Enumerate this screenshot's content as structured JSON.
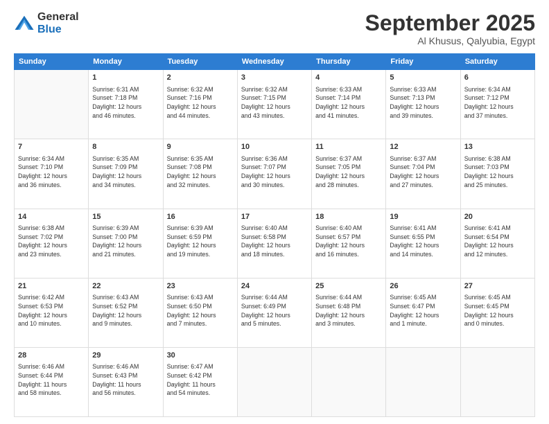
{
  "logo": {
    "general": "General",
    "blue": "Blue"
  },
  "title": "September 2025",
  "location": "Al Khusus, Qalyubia, Egypt",
  "headers": [
    "Sunday",
    "Monday",
    "Tuesday",
    "Wednesday",
    "Thursday",
    "Friday",
    "Saturday"
  ],
  "weeks": [
    [
      {
        "day": "",
        "info": ""
      },
      {
        "day": "1",
        "info": "Sunrise: 6:31 AM\nSunset: 7:18 PM\nDaylight: 12 hours\nand 46 minutes."
      },
      {
        "day": "2",
        "info": "Sunrise: 6:32 AM\nSunset: 7:16 PM\nDaylight: 12 hours\nand 44 minutes."
      },
      {
        "day": "3",
        "info": "Sunrise: 6:32 AM\nSunset: 7:15 PM\nDaylight: 12 hours\nand 43 minutes."
      },
      {
        "day": "4",
        "info": "Sunrise: 6:33 AM\nSunset: 7:14 PM\nDaylight: 12 hours\nand 41 minutes."
      },
      {
        "day": "5",
        "info": "Sunrise: 6:33 AM\nSunset: 7:13 PM\nDaylight: 12 hours\nand 39 minutes."
      },
      {
        "day": "6",
        "info": "Sunrise: 6:34 AM\nSunset: 7:12 PM\nDaylight: 12 hours\nand 37 minutes."
      }
    ],
    [
      {
        "day": "7",
        "info": "Sunrise: 6:34 AM\nSunset: 7:10 PM\nDaylight: 12 hours\nand 36 minutes."
      },
      {
        "day": "8",
        "info": "Sunrise: 6:35 AM\nSunset: 7:09 PM\nDaylight: 12 hours\nand 34 minutes."
      },
      {
        "day": "9",
        "info": "Sunrise: 6:35 AM\nSunset: 7:08 PM\nDaylight: 12 hours\nand 32 minutes."
      },
      {
        "day": "10",
        "info": "Sunrise: 6:36 AM\nSunset: 7:07 PM\nDaylight: 12 hours\nand 30 minutes."
      },
      {
        "day": "11",
        "info": "Sunrise: 6:37 AM\nSunset: 7:05 PM\nDaylight: 12 hours\nand 28 minutes."
      },
      {
        "day": "12",
        "info": "Sunrise: 6:37 AM\nSunset: 7:04 PM\nDaylight: 12 hours\nand 27 minutes."
      },
      {
        "day": "13",
        "info": "Sunrise: 6:38 AM\nSunset: 7:03 PM\nDaylight: 12 hours\nand 25 minutes."
      }
    ],
    [
      {
        "day": "14",
        "info": "Sunrise: 6:38 AM\nSunset: 7:02 PM\nDaylight: 12 hours\nand 23 minutes."
      },
      {
        "day": "15",
        "info": "Sunrise: 6:39 AM\nSunset: 7:00 PM\nDaylight: 12 hours\nand 21 minutes."
      },
      {
        "day": "16",
        "info": "Sunrise: 6:39 AM\nSunset: 6:59 PM\nDaylight: 12 hours\nand 19 minutes."
      },
      {
        "day": "17",
        "info": "Sunrise: 6:40 AM\nSunset: 6:58 PM\nDaylight: 12 hours\nand 18 minutes."
      },
      {
        "day": "18",
        "info": "Sunrise: 6:40 AM\nSunset: 6:57 PM\nDaylight: 12 hours\nand 16 minutes."
      },
      {
        "day": "19",
        "info": "Sunrise: 6:41 AM\nSunset: 6:55 PM\nDaylight: 12 hours\nand 14 minutes."
      },
      {
        "day": "20",
        "info": "Sunrise: 6:41 AM\nSunset: 6:54 PM\nDaylight: 12 hours\nand 12 minutes."
      }
    ],
    [
      {
        "day": "21",
        "info": "Sunrise: 6:42 AM\nSunset: 6:53 PM\nDaylight: 12 hours\nand 10 minutes."
      },
      {
        "day": "22",
        "info": "Sunrise: 6:43 AM\nSunset: 6:52 PM\nDaylight: 12 hours\nand 9 minutes."
      },
      {
        "day": "23",
        "info": "Sunrise: 6:43 AM\nSunset: 6:50 PM\nDaylight: 12 hours\nand 7 minutes."
      },
      {
        "day": "24",
        "info": "Sunrise: 6:44 AM\nSunset: 6:49 PM\nDaylight: 12 hours\nand 5 minutes."
      },
      {
        "day": "25",
        "info": "Sunrise: 6:44 AM\nSunset: 6:48 PM\nDaylight: 12 hours\nand 3 minutes."
      },
      {
        "day": "26",
        "info": "Sunrise: 6:45 AM\nSunset: 6:47 PM\nDaylight: 12 hours\nand 1 minute."
      },
      {
        "day": "27",
        "info": "Sunrise: 6:45 AM\nSunset: 6:45 PM\nDaylight: 12 hours\nand 0 minutes."
      }
    ],
    [
      {
        "day": "28",
        "info": "Sunrise: 6:46 AM\nSunset: 6:44 PM\nDaylight: 11 hours\nand 58 minutes."
      },
      {
        "day": "29",
        "info": "Sunrise: 6:46 AM\nSunset: 6:43 PM\nDaylight: 11 hours\nand 56 minutes."
      },
      {
        "day": "30",
        "info": "Sunrise: 6:47 AM\nSunset: 6:42 PM\nDaylight: 11 hours\nand 54 minutes."
      },
      {
        "day": "",
        "info": ""
      },
      {
        "day": "",
        "info": ""
      },
      {
        "day": "",
        "info": ""
      },
      {
        "day": "",
        "info": ""
      }
    ]
  ]
}
